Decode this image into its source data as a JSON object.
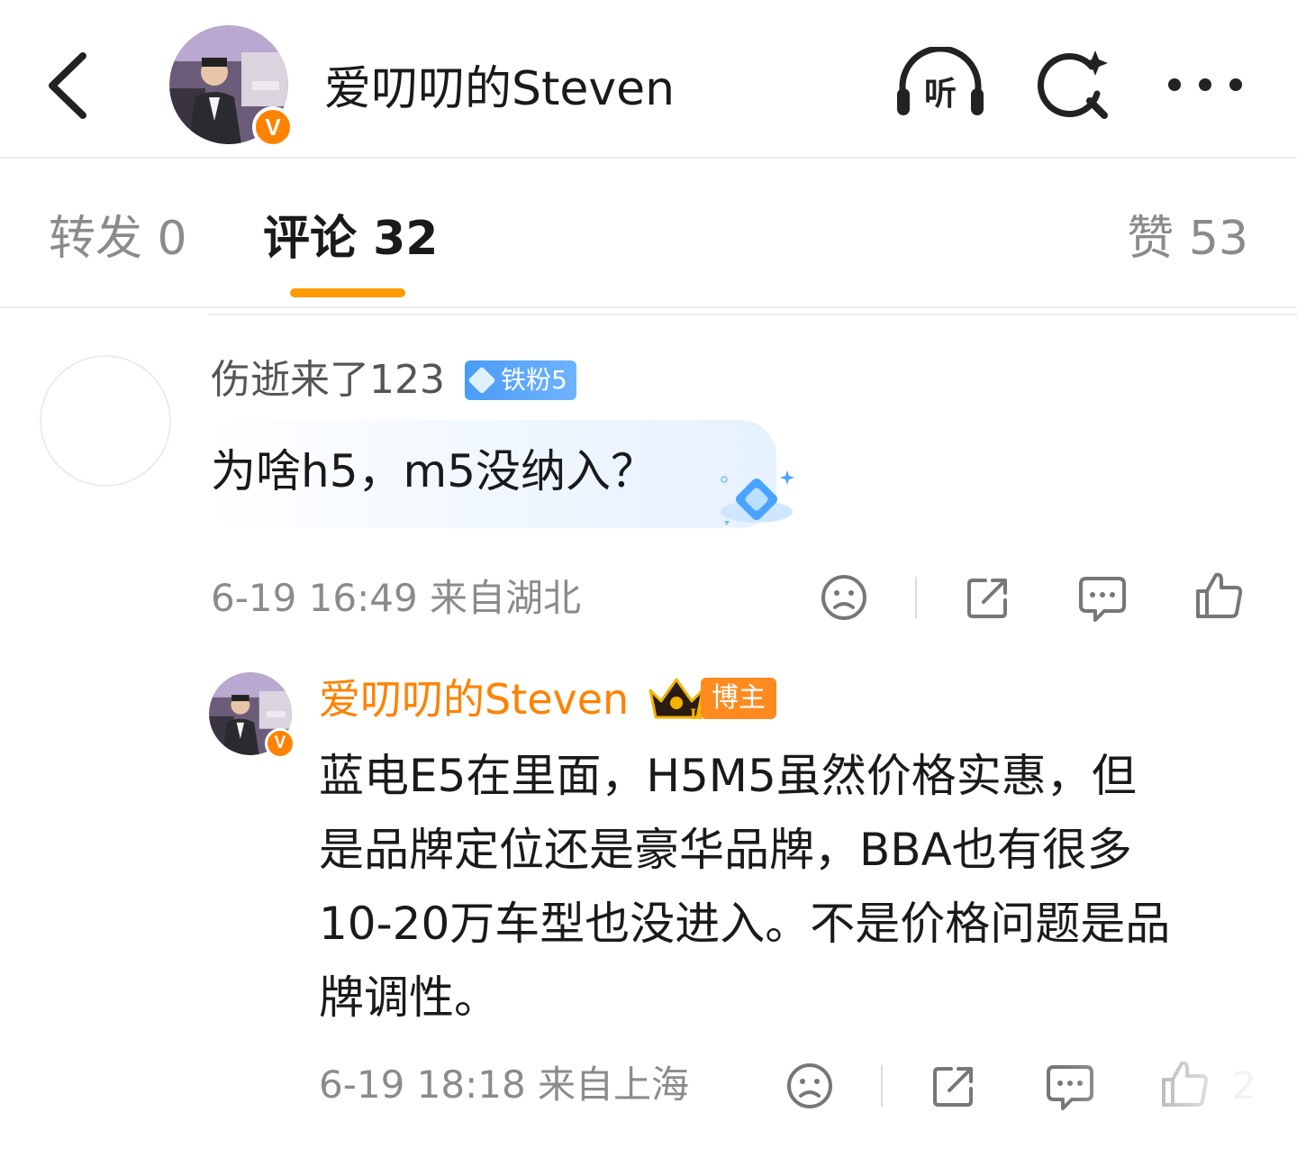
{
  "header": {
    "title": "爱叨叨的Steven",
    "verified_mark": "V",
    "icons": [
      "back-icon",
      "listen-icon",
      "ai-search-icon",
      "more-icon"
    ],
    "listen_label": "听"
  },
  "tabs": {
    "repost": "转发 0",
    "comment": "评论 32",
    "like": "赞 53",
    "accent_color": "#ff9a00"
  },
  "comment": {
    "author": "伤逝来了123",
    "fan_badge": "铁粉5",
    "text": "为啥h5，m5没纳入？",
    "meta": "6-19 16:49  来自湖北"
  },
  "reply": {
    "author": "爱叨叨的Steven",
    "author_color": "#ff8200",
    "verified_mark": "V",
    "crown_mark": "II",
    "role_badge": "博主",
    "lines": [
      "蓝电E5在里面，H5M5虽然价格实惠，但",
      "是品牌定位还是豪华品牌，BBA也有很多",
      "10-20万车型也没进入。不是价格问题是品",
      "牌调性。"
    ],
    "meta": "6-19 18:18  来自上海",
    "like_count": "2"
  }
}
